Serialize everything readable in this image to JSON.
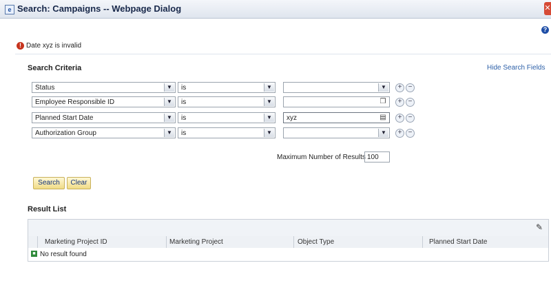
{
  "window": {
    "title": "Search: Campaigns -- Webpage Dialog",
    "close_glyph": "✕",
    "help_glyph": "?"
  },
  "error": {
    "message": "Date xyz is invalid",
    "icon": "error-icon"
  },
  "search_criteria": {
    "title": "Search Criteria",
    "hide_link": "Hide Search Fields",
    "rows": [
      {
        "field": "Status",
        "operator": "is",
        "value": "",
        "value_control": "dropdown"
      },
      {
        "field": "Employee Responsible ID",
        "operator": "is",
        "value": "",
        "value_control": "copy"
      },
      {
        "field": "Planned Start Date",
        "operator": "is",
        "value": "xyz",
        "value_control": "copy"
      },
      {
        "field": "Authorization Group",
        "operator": "is",
        "value": "",
        "value_control": "dropdown"
      }
    ],
    "max_results_label": "Maximum Number of Results",
    "max_results_value": "100"
  },
  "buttons": {
    "search": "Search",
    "clear": "Clear"
  },
  "result_list": {
    "title": "Result List",
    "columns": [
      "Marketing Project ID",
      "Marketing Project",
      "Object Type",
      "Planned Start Date"
    ],
    "empty_message": "No result found"
  }
}
